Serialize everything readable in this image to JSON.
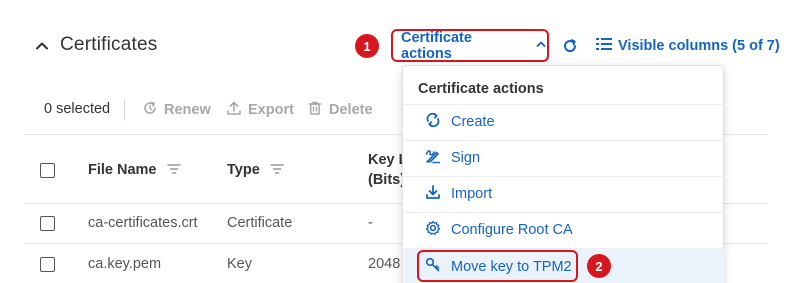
{
  "section": {
    "title": "Certificates",
    "collapse_icon": "chevron-up-icon"
  },
  "header_actions": {
    "certificate_actions_label": "Certificate actions",
    "refresh_icon": "refresh-icon",
    "visible_columns_label": "Visible columns (5 of 7)"
  },
  "badges": {
    "first": "1",
    "second": "2"
  },
  "toolbar": {
    "selected_count": "0 selected",
    "renew_label": "Renew",
    "export_label": "Export",
    "delete_label": "Delete"
  },
  "table": {
    "columns": [
      "File Name",
      "Type",
      "Key L",
      "(Bits)"
    ],
    "rows": [
      {
        "file_name": "ca-certificates.crt",
        "type": "Certificate",
        "key_length": "-"
      },
      {
        "file_name": "ca.key.pem",
        "type": "Key",
        "key_length": "2048"
      }
    ]
  },
  "dropdown": {
    "title": "Certificate actions",
    "items": [
      {
        "label": "Create",
        "icon": "refresh-arrows-icon"
      },
      {
        "label": "Sign",
        "icon": "signature-icon"
      },
      {
        "label": "Import",
        "icon": "download-icon"
      },
      {
        "label": "Configure Root CA",
        "icon": "gear-icon"
      },
      {
        "label": "Move key to TPM2",
        "icon": "key-icon"
      }
    ]
  },
  "colors": {
    "accent": "#1565c0",
    "highlight_red": "#d7171f",
    "disabled": "#a8a8a8",
    "hover_bg": "#eaf3fb"
  }
}
